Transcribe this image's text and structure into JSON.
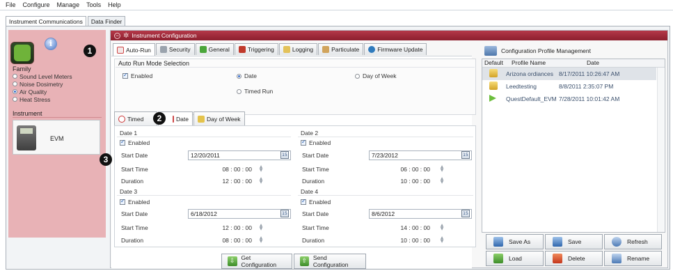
{
  "menu": [
    "File",
    "Configure",
    "Manage",
    "Tools",
    "Help"
  ],
  "app_tabs": [
    "Instrument Communications",
    "Data Finder"
  ],
  "sidebar": {
    "family_label": "Family",
    "family_items": [
      {
        "label": "Sound Level Meters",
        "selected": false
      },
      {
        "label": "Noise Dosimetry",
        "selected": false
      },
      {
        "label": "Air Quality",
        "selected": true
      },
      {
        "label": "Heat Stress",
        "selected": false
      }
    ],
    "instrument_label": "Instrument",
    "instrument_name": "EVM"
  },
  "badges": {
    "one": "1",
    "two": "2",
    "three": "3"
  },
  "config": {
    "header": "Instrument Configuration",
    "tabs": [
      "Auto-Run",
      "Security",
      "General",
      "Triggering",
      "Logging",
      "Particulate",
      "Firmware Update"
    ],
    "active_tab": "Auto-Run",
    "auto_run": {
      "section_title": "Auto Run Mode Selection",
      "enabled_label": "Enabled",
      "enabled": true,
      "modes": [
        {
          "label": "Date",
          "selected": true
        },
        {
          "label": "Day of Week",
          "selected": false
        },
        {
          "label": "Timed Run",
          "selected": false
        }
      ]
    },
    "subtabs": [
      "Timed",
      "Date",
      "Day of Week"
    ],
    "active_subtab": "Date",
    "field_labels": {
      "start_date": "Start Date",
      "start_time": "Start Time",
      "duration": "Duration",
      "enabled": "Enabled"
    },
    "dates": [
      {
        "title": "Date 1",
        "enabled": true,
        "start_date": "12/20/2011",
        "start_time": "08 : 00 : 00",
        "duration": "12 : 00 : 00"
      },
      {
        "title": "Date 2",
        "enabled": true,
        "start_date": "7/23/2012",
        "start_time": "06 : 00 : 00",
        "duration": "10 : 00 : 00"
      },
      {
        "title": "Date 3",
        "enabled": true,
        "start_date": "6/18/2012",
        "start_time": "12 : 00 : 00",
        "duration": "08 : 00 : 00"
      },
      {
        "title": "Date 4",
        "enabled": true,
        "start_date": "8/6/2012",
        "start_time": "14 : 00 : 00",
        "duration": "10 : 00 : 00"
      }
    ],
    "calendar_glyph": "15",
    "buttons": {
      "get": "Get Configuration",
      "send": "Send Configuration"
    }
  },
  "profiles": {
    "title": "Configuration Profile Management",
    "columns": [
      "Default",
      "Profile Name",
      "Date"
    ],
    "rows": [
      {
        "name": "Arizona ordiances",
        "date": "8/17/2011 10:26:47 AM",
        "icon": "lock-open-icon",
        "selected": true
      },
      {
        "name": "Leedtesting",
        "date": "8/8/2011 2:35:07 PM",
        "icon": "lock-open-icon",
        "selected": false
      },
      {
        "name": "QuestDefault_EVM",
        "date": "7/28/2011 10:01:42 AM",
        "icon": "green-arrow-icon",
        "selected": false
      }
    ],
    "buttons": {
      "save_as": "Save As",
      "save": "Save",
      "refresh": "Refresh",
      "load": "Load",
      "delete": "Delete",
      "rename": "Rename"
    }
  },
  "colors": {
    "header_red": "#9c2433",
    "sidebar_pink": "#e8b2b6",
    "selected_row": "#dfe3e8"
  }
}
